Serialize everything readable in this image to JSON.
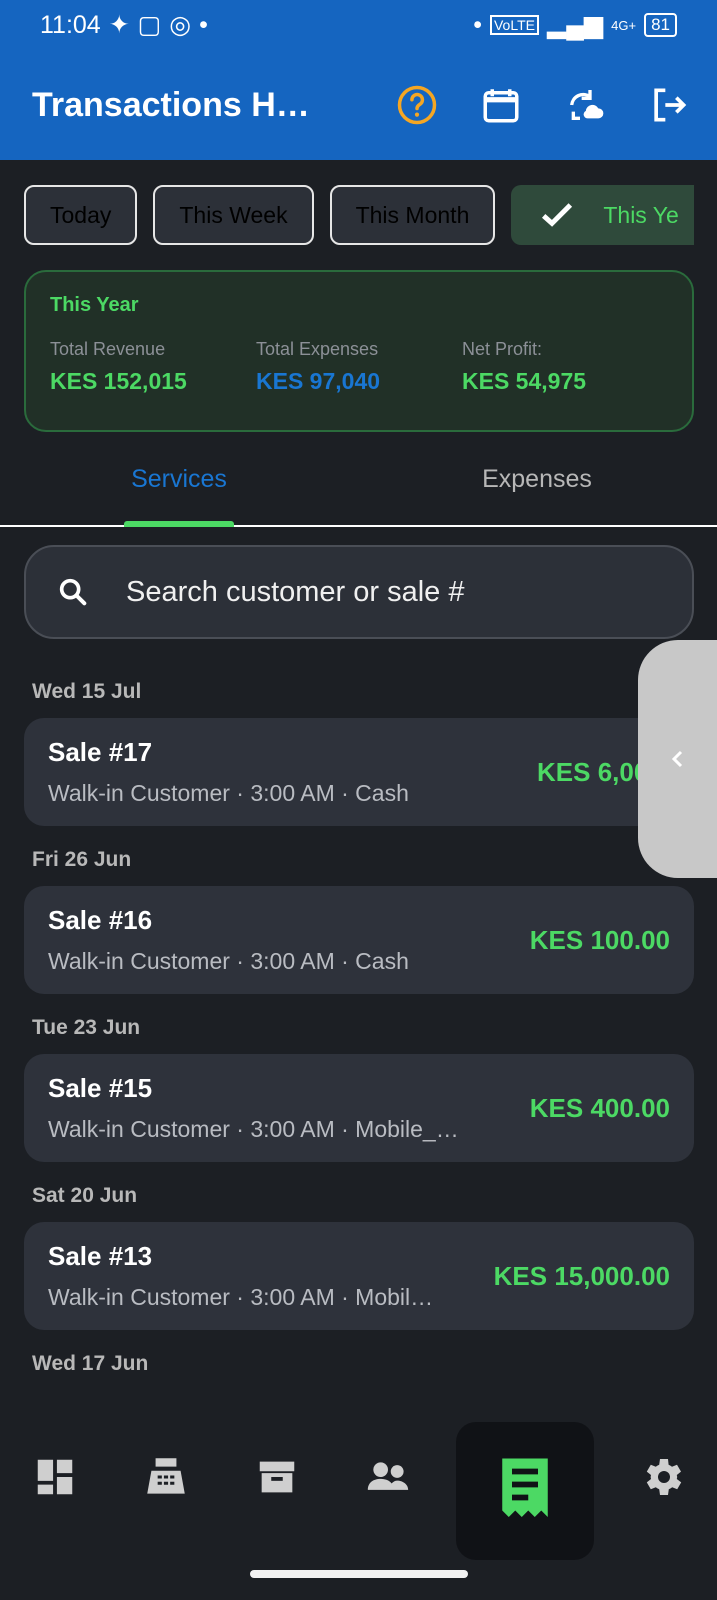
{
  "status": {
    "time": "11:04",
    "network": "4G+",
    "battery": "81"
  },
  "appbar": {
    "title": "Transactions H…"
  },
  "filters": [
    "Today",
    "This Week",
    "This Month",
    "This Ye"
  ],
  "summary": {
    "title": "This Year",
    "revenue_label": "Total Revenue",
    "revenue_value": "KES 152,015",
    "expenses_label": "Total Expenses",
    "expenses_value": "KES 97,040",
    "profit_label": "Net Profit:",
    "profit_value": "KES 54,975"
  },
  "tabs": [
    "Services",
    "Expenses"
  ],
  "search": {
    "placeholder": "Search customer or sale #"
  },
  "dates": [
    "Wed 15 Jul",
    "Fri 26 Jun",
    "Tue 23 Jun",
    "Sat 20 Jun",
    "Wed 17 Jun"
  ],
  "sales": [
    {
      "title": "Sale #17",
      "sub": "Walk-in Customer · 3:00 AM · Cash",
      "amount": "KES 6,000."
    },
    {
      "title": "Sale #16",
      "sub": "Walk-in Customer · 3:00 AM · Cash",
      "amount": "KES 100.00"
    },
    {
      "title": "Sale #15",
      "sub": "Walk-in Customer · 3:00 AM · Mobile_…",
      "amount": "KES 400.00"
    },
    {
      "title": "Sale #13",
      "sub": "Walk-in Customer · 3:00 AM · Mobil…",
      "amount": "KES 15,000.00"
    }
  ],
  "colors": {
    "primary": "#1565c0",
    "success": "#4cd964",
    "accent": "#f5a623"
  },
  "icons": [
    "help-icon",
    "calendar-icon",
    "sync-icon",
    "logout-icon",
    "search-icon",
    "chevron-left-icon",
    "dashboard-icon",
    "cash-register-icon",
    "archive-icon",
    "people-icon",
    "receipt-icon",
    "gear-icon"
  ]
}
